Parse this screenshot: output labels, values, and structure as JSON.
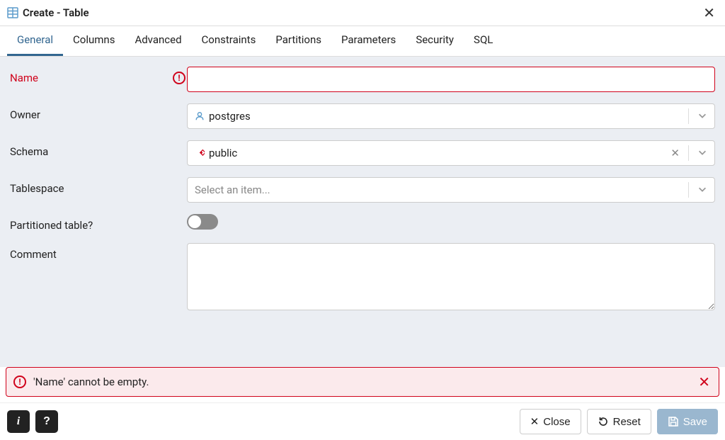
{
  "title": "Create - Table",
  "tabs": [
    "General",
    "Columns",
    "Advanced",
    "Constraints",
    "Partitions",
    "Parameters",
    "Security",
    "SQL"
  ],
  "active_tab_index": 0,
  "form": {
    "name": {
      "label": "Name",
      "value": "",
      "error": true
    },
    "owner": {
      "label": "Owner",
      "value": "postgres"
    },
    "schema": {
      "label": "Schema",
      "value": "public"
    },
    "tablespace": {
      "label": "Tablespace",
      "placeholder": "Select an item..."
    },
    "partitioned": {
      "label": "Partitioned table?",
      "value": false
    },
    "comment": {
      "label": "Comment",
      "value": ""
    }
  },
  "error_message": "'Name' cannot be empty.",
  "footer": {
    "close": "Close",
    "reset": "Reset",
    "save": "Save"
  }
}
